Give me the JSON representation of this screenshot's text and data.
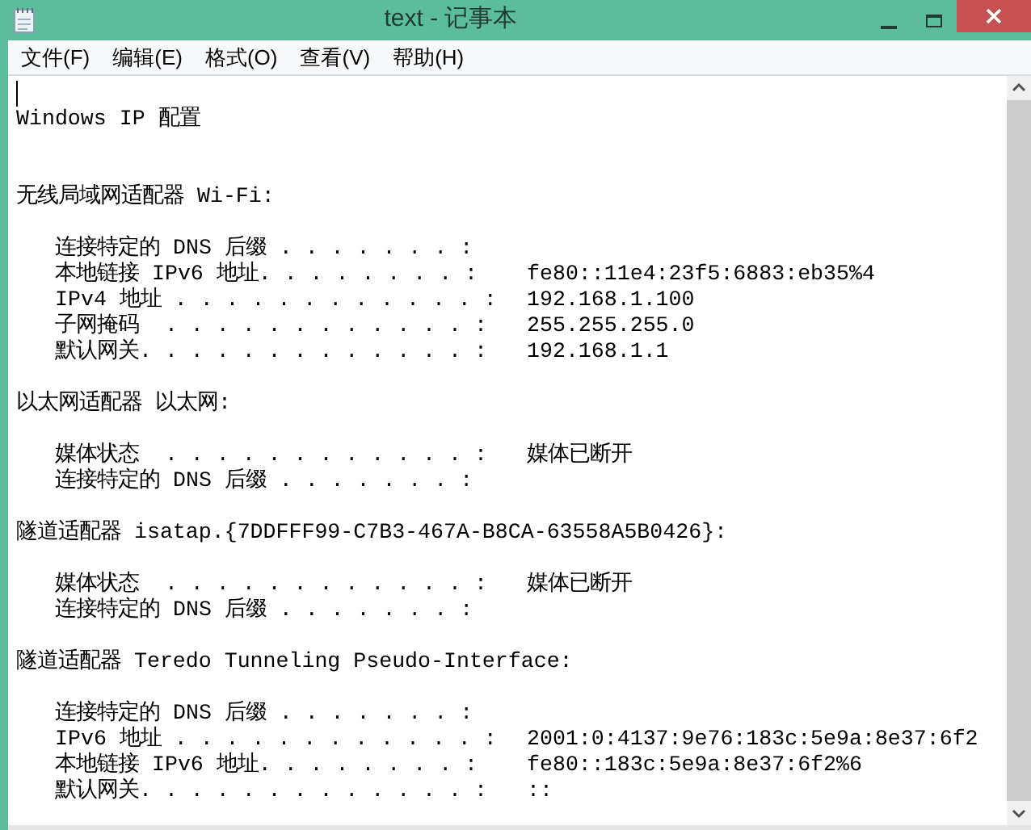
{
  "window": {
    "title": "text - 记事本"
  },
  "menu": [
    {
      "label": "文件(F)"
    },
    {
      "label": "编辑(E)"
    },
    {
      "label": "格式(O)"
    },
    {
      "label": "查看(V)"
    },
    {
      "label": "帮助(H)"
    }
  ],
  "document": {
    "lines": [
      {
        "kind": "caret"
      },
      {
        "kind": "heading",
        "text": "Windows IP 配置"
      },
      {
        "kind": "blank"
      },
      {
        "kind": "blank"
      },
      {
        "kind": "heading",
        "text": "无线局域网适配器 Wi-Fi:"
      },
      {
        "kind": "blank"
      },
      {
        "kind": "entry",
        "label": "连接特定的 DNS 后缀 . . . . . . . :"
      },
      {
        "kind": "entry",
        "label": "本地链接 IPv6 地址. . . . . . . . :",
        "value": "fe80::11e4:23f5:6883:eb35%4"
      },
      {
        "kind": "entry",
        "label": "IPv4 地址 . . . . . . . . . . . . :",
        "value": "192.168.1.100"
      },
      {
        "kind": "entry",
        "label": "子网掩码  . . . . . . . . . . . . :",
        "value": "255.255.255.0"
      },
      {
        "kind": "entry",
        "label": "默认网关. . . . . . . . . . . . . :",
        "value": "192.168.1.1"
      },
      {
        "kind": "blank"
      },
      {
        "kind": "heading",
        "text": "以太网适配器 以太网:"
      },
      {
        "kind": "blank"
      },
      {
        "kind": "entry",
        "label": "媒体状态  . . . . . . . . . . . . :",
        "value": "媒体已断开"
      },
      {
        "kind": "entry",
        "label": "连接特定的 DNS 后缀 . . . . . . . :"
      },
      {
        "kind": "blank"
      },
      {
        "kind": "heading",
        "text": "隧道适配器 isatap.{7DDFFF99-C7B3-467A-B8CA-63558A5B0426}:"
      },
      {
        "kind": "blank"
      },
      {
        "kind": "entry",
        "label": "媒体状态  . . . . . . . . . . . . :",
        "value": "媒体已断开"
      },
      {
        "kind": "entry",
        "label": "连接特定的 DNS 后缀 . . . . . . . :"
      },
      {
        "kind": "blank"
      },
      {
        "kind": "heading",
        "text": "隧道适配器 Teredo Tunneling Pseudo-Interface:"
      },
      {
        "kind": "blank"
      },
      {
        "kind": "entry",
        "label": "连接特定的 DNS 后缀 . . . . . . . :"
      },
      {
        "kind": "entry",
        "label": "IPv6 地址 . . . . . . . . . . . . :",
        "value": "2001:0:4137:9e76:183c:5e9a:8e37:6f2"
      },
      {
        "kind": "entry",
        "label": "本地链接 IPv6 地址. . . . . . . . :",
        "value": "fe80::183c:5e9a:8e37:6f2%6"
      },
      {
        "kind": "entry",
        "label": "默认网关. . . . . . . . . . . . . :",
        "value": "::"
      }
    ]
  }
}
